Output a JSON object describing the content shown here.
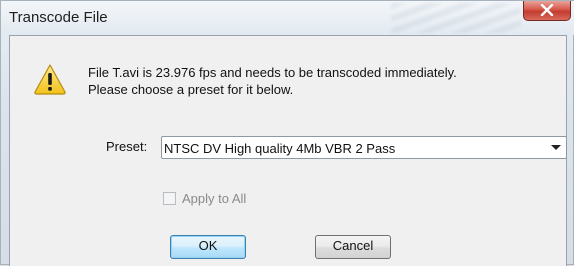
{
  "window": {
    "title": "Transcode File",
    "close_icon": "close-icon"
  },
  "message": {
    "icon": "warning-icon",
    "line1": "File T.avi is 23.976 fps and needs to be transcoded immediately.",
    "line2": "Please choose a preset for it below."
  },
  "preset": {
    "label": "Preset:",
    "selected": "NTSC DV High quality 4Mb VBR 2 Pass"
  },
  "apply_all": {
    "label": "Apply to All",
    "checked": false,
    "enabled": false
  },
  "buttons": {
    "ok": "OK",
    "cancel": "Cancel"
  },
  "colors": {
    "close_red": "#c33b2e",
    "warning_yellow": "#f7d02c",
    "default_button_border": "#3c7fb1"
  }
}
